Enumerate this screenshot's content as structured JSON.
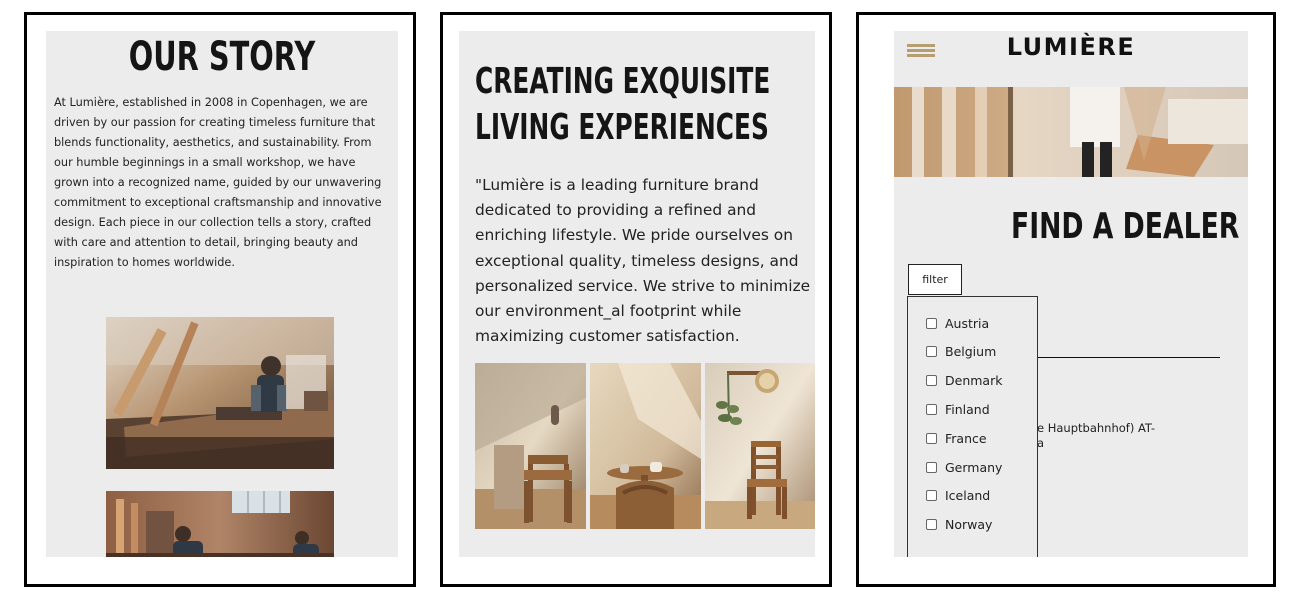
{
  "story": {
    "title": "OUR STORY",
    "body": "At Lumière, established in 2008 in Copenhagen, we are driven by our passion for creating timeless furniture that blends functionality, aesthetics, and sustainability. From our humble beginnings in a small workshop, we have grown into a recognized name, guided by our unwavering commitment to exceptional craftsmanship and innovative design. Each piece in our collection tells a story, crafted with care and attention to detail, bringing beauty and inspiration to homes worldwide."
  },
  "living": {
    "title": "CREATING EXQUISITE LIVING EXPERIENCES",
    "quote": "\"Lumière is a leading furniture brand dedicated to providing a refined and enriching lifestyle. We pride ourselves on exceptional quality, timeless designs, and personalized service. We strive to minimize our environment_al footprint while maximizing customer satisfaction."
  },
  "dealer": {
    "brand": "LUMIÈRE",
    "title": "FIND A DEALER",
    "filter_label": "filter",
    "countries": [
      "Austria",
      "Belgium",
      "Denmark",
      "Finland",
      "France",
      "Germany",
      "Iceland",
      "Norway"
    ],
    "address": "e Hauptbahnhof) AT-\na"
  },
  "icons": {
    "menu": "hamburger-menu-icon",
    "checkbox": "checkbox-icon"
  },
  "colors": {
    "panel_background": "#ececec",
    "frame_border": "#000000",
    "menu_accent": "#b79d72",
    "heading_text": "#151515"
  }
}
